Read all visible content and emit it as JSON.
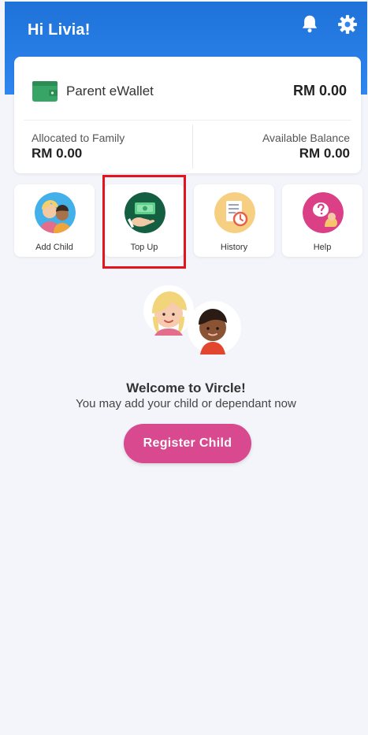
{
  "header": {
    "greeting": "Hi Livia!",
    "icons": [
      "bell-icon",
      "gear-icon"
    ],
    "color": "#2f86ef"
  },
  "wallet": {
    "label": "Parent eWallet",
    "total": "RM 0.00",
    "allocated_label": "Allocated to Family",
    "allocated_value": "RM 0.00",
    "available_label": "Available Balance",
    "available_value": "RM 0.00"
  },
  "actions": [
    {
      "label": "Add Child",
      "icon": "add-child-icon"
    },
    {
      "label": "Top Up",
      "icon": "top-up-icon"
    },
    {
      "label": "History",
      "icon": "history-icon"
    },
    {
      "label": "Help",
      "icon": "help-icon"
    }
  ],
  "welcome": {
    "title": "Welcome to Vircle!",
    "subtitle": "You may add your child or dependant now"
  },
  "register_button": {
    "label": "Register Child",
    "color": "#d8498f"
  },
  "highlight_color": "#e3141b"
}
